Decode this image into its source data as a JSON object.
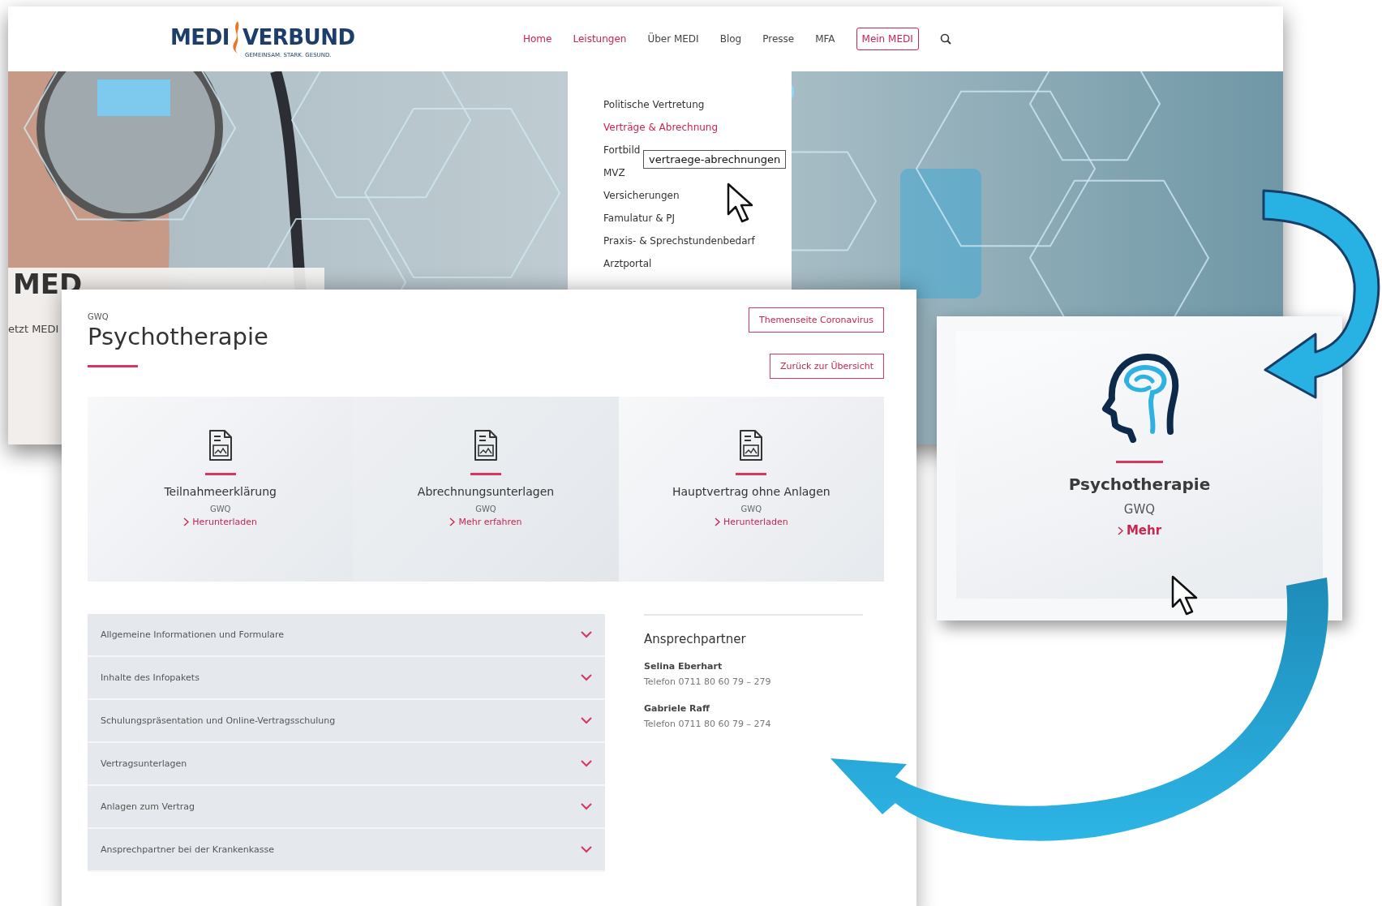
{
  "back_page": {
    "logo": {
      "word_left": "MEDI",
      "word_right": "VERBUND",
      "tagline": "GEMEINSAM. STARK. GESUND."
    },
    "nav": [
      {
        "label": "Home",
        "active": true
      },
      {
        "label": "Leistungen",
        "active": true
      },
      {
        "label": "Über MEDI",
        "active": false
      },
      {
        "label": "Blog",
        "active": false
      },
      {
        "label": "Presse",
        "active": false
      },
      {
        "label": "MFA",
        "active": false
      }
    ],
    "account_button": "Mein MEDI",
    "dropdown": [
      {
        "label": "Politische Vertretung",
        "selected": false
      },
      {
        "label": "Verträge & Abrechnung",
        "selected": true
      },
      {
        "label": "Fortbild",
        "selected": false
      },
      {
        "label": "MVZ",
        "selected": false
      },
      {
        "label": "Versicherungen",
        "selected": false
      },
      {
        "label": "Famulatur & PJ",
        "selected": false
      },
      {
        "label": "Praxis- & Sprechstundenbedarf",
        "selected": false
      },
      {
        "label": "Arztportal",
        "selected": false
      }
    ],
    "tooltip": "vertraege-abrechnungen",
    "hero_title": "MED",
    "hero_text": "etzt MEDI"
  },
  "detail_page": {
    "category": "GWQ",
    "title": "Psychotherapie",
    "buttons": [
      "Themenseite Coronavirus",
      "Zurück zur Übersicht"
    ],
    "documents": [
      {
        "title": "Teilnahmeerklärung",
        "provider": "GWQ",
        "link": "Herunterladen"
      },
      {
        "title": "Abrechnungsunterlagen",
        "provider": "GWQ",
        "link": "Mehr erfahren"
      },
      {
        "title": "Hauptvertrag ohne Anlagen",
        "provider": "GWQ",
        "link": "Herunterladen"
      }
    ],
    "accordion": [
      {
        "label": "Allgemeine Informationen und Formulare",
        "expanded": false
      },
      {
        "label": "Inhalte des Infopakets",
        "expanded": false
      },
      {
        "label": "Schulungspräsentation und Online-Vertragsschulung",
        "expanded": false
      },
      {
        "label": "Vertragsunterlagen",
        "expanded": false
      },
      {
        "label": "Anlagen zum Vertrag",
        "expanded": false
      },
      {
        "label": "Ansprechpartner bei der Krankenkasse",
        "expanded": false
      }
    ],
    "contacts": {
      "heading": "Ansprechpartner",
      "people": [
        {
          "name": "Selina Eberhart",
          "phone": "Telefon 0711 80 60 79 – 279"
        },
        {
          "name": "Gabriele Raff",
          "phone": "Telefon 0711 80 60 79 – 274"
        }
      ]
    }
  },
  "tile": {
    "title": "Psychotherapie",
    "provider": "GWQ",
    "link": "Mehr"
  }
}
